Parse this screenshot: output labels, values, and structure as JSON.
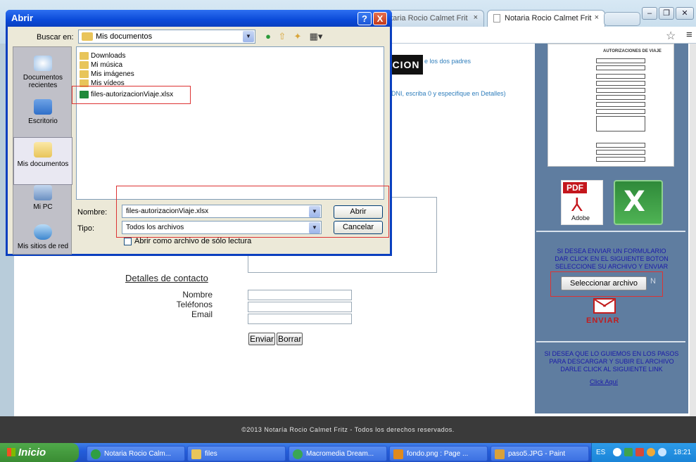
{
  "browser": {
    "tabs": [
      {
        "label": "otaria Rocio Calmet Frit"
      },
      {
        "label": "Notaria Rocio Calmet Frit"
      }
    ],
    "tab_close": "×"
  },
  "page": {
    "banner_word": "CION",
    "intro_text": "e los dos padres",
    "dni_text": "DNI, escriba 0 y especifique en Detalles)",
    "contact_heading": "Detalles de contacto",
    "labels": {
      "name": "Nombre",
      "phones": "Teléfonos",
      "email": "Email"
    },
    "buttons": {
      "send": "Enviar",
      "clear": "Borrar"
    },
    "footer": "©2013 Notaría Rocio Calmet Fritz - Todos los derechos reservados."
  },
  "sidebar": {
    "thumbnail_title": "AUTORIZACIONES DE VIAJE",
    "pdf_badge": "PDF",
    "pdf_caption": "Adobe",
    "excel_letter": "X",
    "send_form_text": [
      "SI DESEA ENVIAR UN FORMULARIO",
      "DAR CLICK EN EL SIGUIENTE BOTON",
      "SELECCIONE SU ARCHIVO Y ENVIAR"
    ],
    "select_file_button": "Seleccionar archivo",
    "send_label": "ENVIAR",
    "guide_text": [
      "SI DESEA QUE LO GUIEMOS EN LOS PASOS",
      "PARA DESCARGAR Y SUBIR EL ARCHIVO",
      "DARLE CLICK AL SIGUIENTE LINK"
    ],
    "link": "Click Aquí"
  },
  "dialog": {
    "title": "Abrir",
    "help": "?",
    "close": "X",
    "look_in_label": "Buscar en:",
    "look_in_value": "Mis documentos",
    "places": [
      "Documentos recientes",
      "Escritorio",
      "Mis documentos",
      "Mi PC",
      "Mis sitios de red"
    ],
    "files": [
      "Downloads",
      "Mi música",
      "Mis imágenes",
      "Mis vídeos",
      "files-autorizacionViaje.xlsx"
    ],
    "name_label": "Nombre:",
    "name_value": "files-autorizacionViaje.xlsx",
    "type_label": "Tipo:",
    "type_value": "Todos los archivos",
    "open_button": "Abrir",
    "cancel_button": "Cancelar",
    "readonly_label": "Abrir como archivo de sólo lectura"
  },
  "taskbar": {
    "start": "Inicio",
    "tasks": [
      "Notaria Rocio Calm...",
      "files",
      "Macromedia Dream...",
      "fondo.png : Page ...",
      "paso5.JPG - Paint"
    ],
    "lang": "ES",
    "clock": "18:21"
  },
  "colors": {
    "dialog_title": "#0b4ad8",
    "sidebar_bg": "#5f7da0",
    "highlight": "#dd3333",
    "sidebar_text": "#1a1aa8",
    "taskbar": "#245edb"
  }
}
